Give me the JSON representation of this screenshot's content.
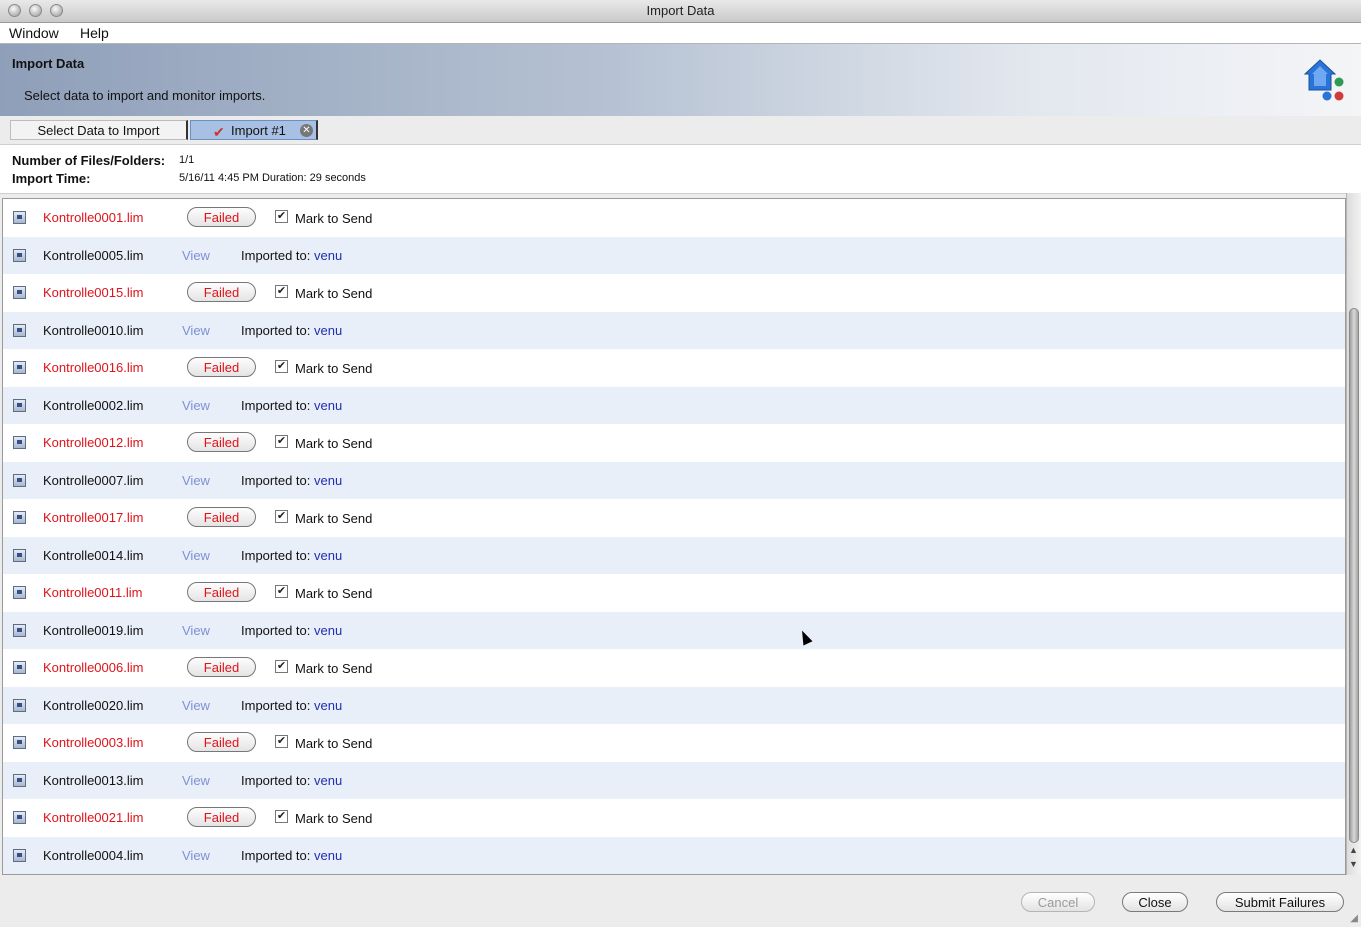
{
  "window": {
    "title": "Import Data"
  },
  "menubar": {
    "items": [
      "Window",
      "Help"
    ]
  },
  "header": {
    "title": "Import Data",
    "subtitle": "Select data to import and monitor imports."
  },
  "tabs": [
    {
      "label": "Select Data to Import",
      "active": false
    },
    {
      "label": "Import #1",
      "active": true
    }
  ],
  "info": {
    "files_label": "Number of Files/Folders:",
    "files_value": "1/1",
    "time_label": "Import Time:",
    "time_value": "5/16/11 4:45 PM Duration:  29 seconds"
  },
  "status_colors": {
    "failed": "#e0131a",
    "link": "#1f2fb0",
    "alt_row": "#e9eff9"
  },
  "rows": [
    {
      "name": "Kontrolle0001.lim",
      "status": "failed",
      "action": "Failed",
      "mark": "Mark to Send",
      "checked": true
    },
    {
      "name": "Kontrolle0005.lim",
      "status": "ok",
      "action": "View",
      "imported_label": "Imported to:",
      "dest": "venu"
    },
    {
      "name": "Kontrolle0015.lim",
      "status": "failed",
      "action": "Failed",
      "mark": "Mark to Send",
      "checked": true
    },
    {
      "name": "Kontrolle0010.lim",
      "status": "ok",
      "action": "View",
      "imported_label": "Imported to:",
      "dest": "venu"
    },
    {
      "name": "Kontrolle0016.lim",
      "status": "failed",
      "action": "Failed",
      "mark": "Mark to Send",
      "checked": true
    },
    {
      "name": "Kontrolle0002.lim",
      "status": "ok",
      "action": "View",
      "imported_label": "Imported to:",
      "dest": "venu"
    },
    {
      "name": "Kontrolle0012.lim",
      "status": "failed",
      "action": "Failed",
      "mark": "Mark to Send",
      "checked": true
    },
    {
      "name": "Kontrolle0007.lim",
      "status": "ok",
      "action": "View",
      "imported_label": "Imported to:",
      "dest": "venu"
    },
    {
      "name": "Kontrolle0017.lim",
      "status": "failed",
      "action": "Failed",
      "mark": "Mark to Send",
      "checked": true
    },
    {
      "name": "Kontrolle0014.lim",
      "status": "ok",
      "action": "View",
      "imported_label": "Imported to:",
      "dest": "venu"
    },
    {
      "name": "Kontrolle0011.lim",
      "status": "failed",
      "action": "Failed",
      "mark": "Mark to Send",
      "checked": true
    },
    {
      "name": "Kontrolle0019.lim",
      "status": "ok",
      "action": "View",
      "imported_label": "Imported to:",
      "dest": "venu"
    },
    {
      "name": "Kontrolle0006.lim",
      "status": "failed",
      "action": "Failed",
      "mark": "Mark to Send",
      "checked": true
    },
    {
      "name": "Kontrolle0020.lim",
      "status": "ok",
      "action": "View",
      "imported_label": "Imported to:",
      "dest": "venu"
    },
    {
      "name": "Kontrolle0003.lim",
      "status": "failed",
      "action": "Failed",
      "mark": "Mark to Send",
      "checked": true
    },
    {
      "name": "Kontrolle0013.lim",
      "status": "ok",
      "action": "View",
      "imported_label": "Imported to:",
      "dest": "venu"
    },
    {
      "name": "Kontrolle0021.lim",
      "status": "failed",
      "action": "Failed",
      "mark": "Mark to Send",
      "checked": true
    },
    {
      "name": "Kontrolle0004.lim",
      "status": "ok",
      "action": "View",
      "imported_label": "Imported to:",
      "dest": "venu"
    }
  ],
  "footer": {
    "cancel_label": "Cancel",
    "close_label": "Close",
    "submit_label": "Submit Failures"
  }
}
